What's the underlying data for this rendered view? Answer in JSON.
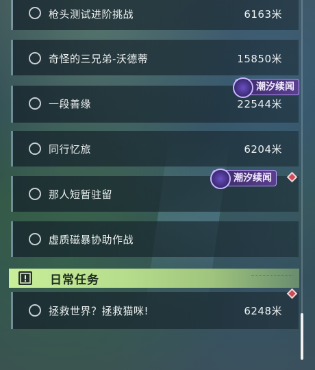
{
  "quests": [
    {
      "name": "枪头测试进阶挑战",
      "distance": "6163米"
    },
    {
      "name": "奇怪的三兄弟-沃德蒂",
      "distance": "15850米"
    },
    {
      "name": "一段善缘",
      "distance": "22544米"
    },
    {
      "name": "同行忆旅",
      "distance": "6204米"
    },
    {
      "name": "那人短暂驻留",
      "distance": ""
    },
    {
      "name": "虚质磁暴协助作战",
      "distance": ""
    }
  ],
  "tags": {
    "tag1": "潮汐续闻",
    "tag2": "潮汐续闻"
  },
  "daily_section": {
    "title": "日常任务",
    "icon": "exclamation-icon"
  },
  "daily_quests": [
    {
      "name": "拯救世界？拯救猫咪!",
      "distance": "6248米"
    }
  ],
  "colors": {
    "tag_bg": "#5b3f8e",
    "section_header": "#c9ee9a",
    "marker": "#d04a57"
  }
}
